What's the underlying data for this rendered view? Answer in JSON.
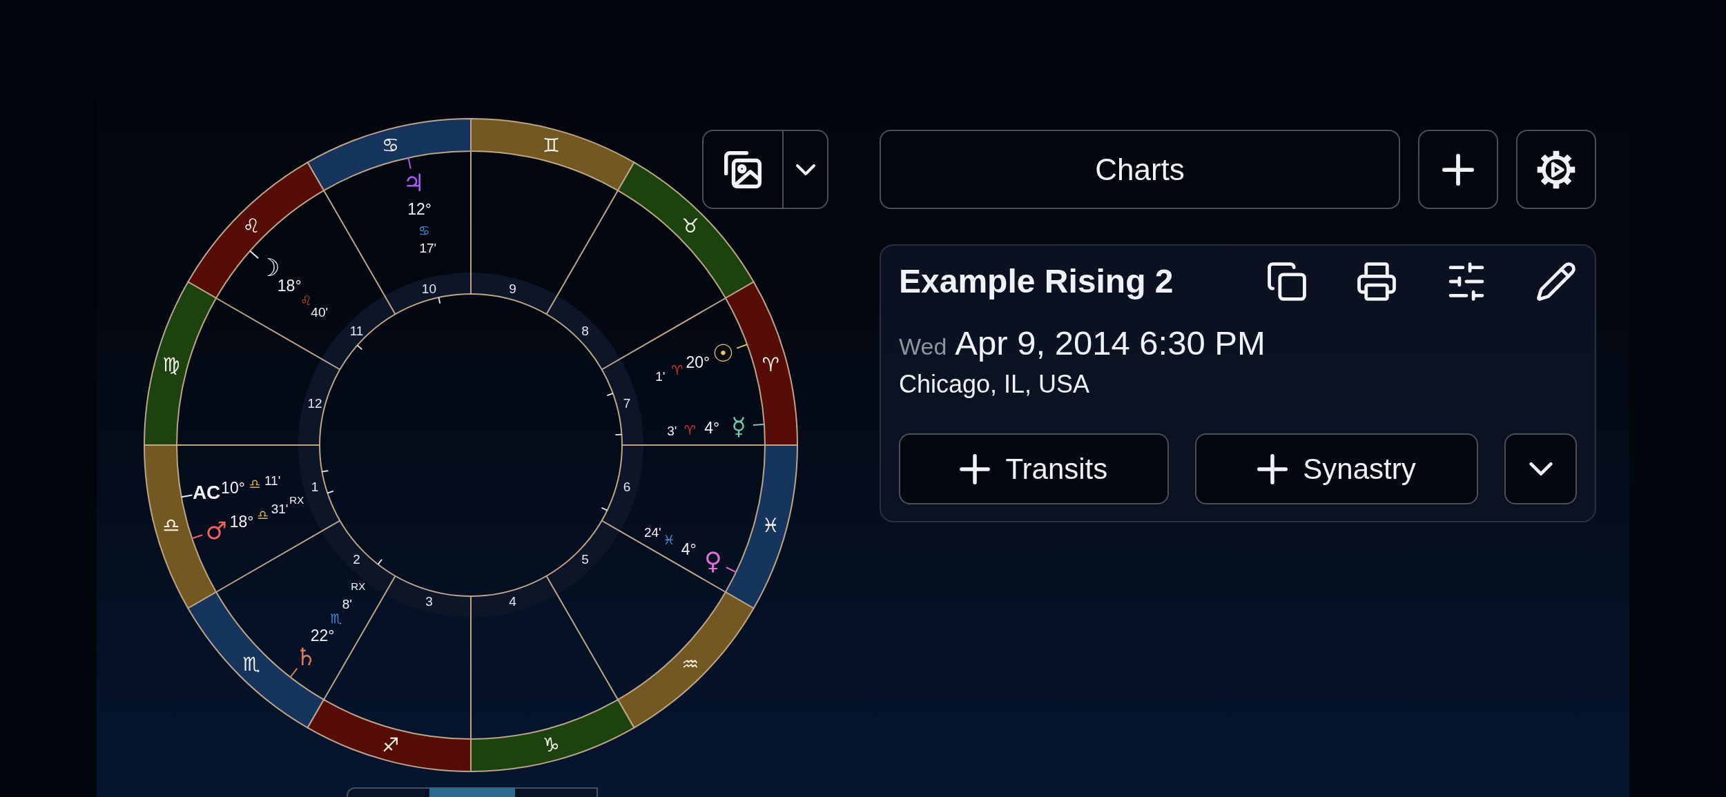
{
  "wheel": {
    "left_half": [
      {
        "glyph": "♋︎",
        "color": "#15345e",
        "points": [
          {
            "kind": "planet",
            "glyph": "♃",
            "color": "#a75af0",
            "degree": "12°",
            "sign": {
              "glyph": "♋︎",
              "color": "#3e90db"
            },
            "minutes": "17'"
          }
        ]
      },
      {
        "glyph": "♌︎",
        "color": "#560d07",
        "points": [
          {
            "kind": "planet",
            "glyph": "☽",
            "color": "#dce6f7",
            "degree": "18°",
            "sign": {
              "glyph": "♌︎",
              "color": "#d1362c"
            },
            "minutes": "40'"
          }
        ]
      },
      {
        "glyph": "♍︎",
        "color": "#1c4210"
      },
      {
        "glyph": "♎︎",
        "color": "#725921",
        "points": [
          {
            "kind": "angle",
            "label": "AC",
            "degree": "10°",
            "sign": {
              "glyph": "♎︎",
              "color": "#e0ae36"
            },
            "minutes": "11'"
          },
          {
            "kind": "planet",
            "glyph": "♂",
            "color": "#ec615c",
            "degree": "18°",
            "sign": {
              "glyph": "♎︎",
              "color": "#e0ae36"
            },
            "minutes": "31'",
            "retrograde": "RX"
          }
        ]
      },
      {
        "glyph": "♏︎",
        "color": "#15345e",
        "points": [
          {
            "kind": "planet",
            "glyph": "♄",
            "color": "#dc7a55",
            "degree": "22°",
            "sign": {
              "glyph": "♏︎",
              "color": "#3e90db"
            },
            "minutes": "8'",
            "retrograde": "RX"
          }
        ]
      },
      {
        "glyph": "♐︎",
        "color": "#560d07"
      }
    ],
    "right_half": [
      {
        "glyph": "♊︎",
        "color": "#725921"
      },
      {
        "glyph": "♉︎",
        "color": "#1c4210"
      },
      {
        "glyph": "♈︎",
        "color": "#560d07",
        "points": [
          {
            "kind": "planet",
            "glyph": "☉",
            "color": "#edc653",
            "degree": "20°",
            "sign": {
              "glyph": "♈︎",
              "color": "#d1362c"
            },
            "minutes": "1'"
          },
          {
            "kind": "planet",
            "glyph": "☿",
            "color": "#70cfa6",
            "degree": "4°",
            "sign": {
              "glyph": "♈︎",
              "color": "#d1362c"
            },
            "minutes": "3'"
          }
        ]
      },
      {
        "glyph": "♓︎",
        "color": "#15345e",
        "points": [
          {
            "kind": "planet",
            "glyph": "♀",
            "color": "#e06fd6",
            "degree": "4°",
            "sign": {
              "glyph": "♓︎",
              "color": "#3e90db"
            },
            "minutes": "24'"
          }
        ]
      },
      {
        "glyph": "♒︎",
        "color": "#725921"
      },
      {
        "glyph": "♑︎",
        "color": "#1c4210"
      }
    ],
    "houses": [
      "1",
      "2",
      "3",
      "4",
      "5",
      "6",
      "7",
      "8",
      "9",
      "10",
      "11",
      "12"
    ]
  },
  "charts_button": {
    "label": "Charts"
  },
  "chart_card": {
    "title": "Example Rising 2",
    "weekday": "Wed",
    "datetime": "Apr 9, 2014 6:30 PM",
    "location": "Chicago, IL, USA",
    "buttons": [
      "Transits",
      "Synastry"
    ]
  },
  "view_tabs": [
    {
      "selected": false
    },
    {
      "selected": true
    },
    {
      "selected": false
    }
  ]
}
